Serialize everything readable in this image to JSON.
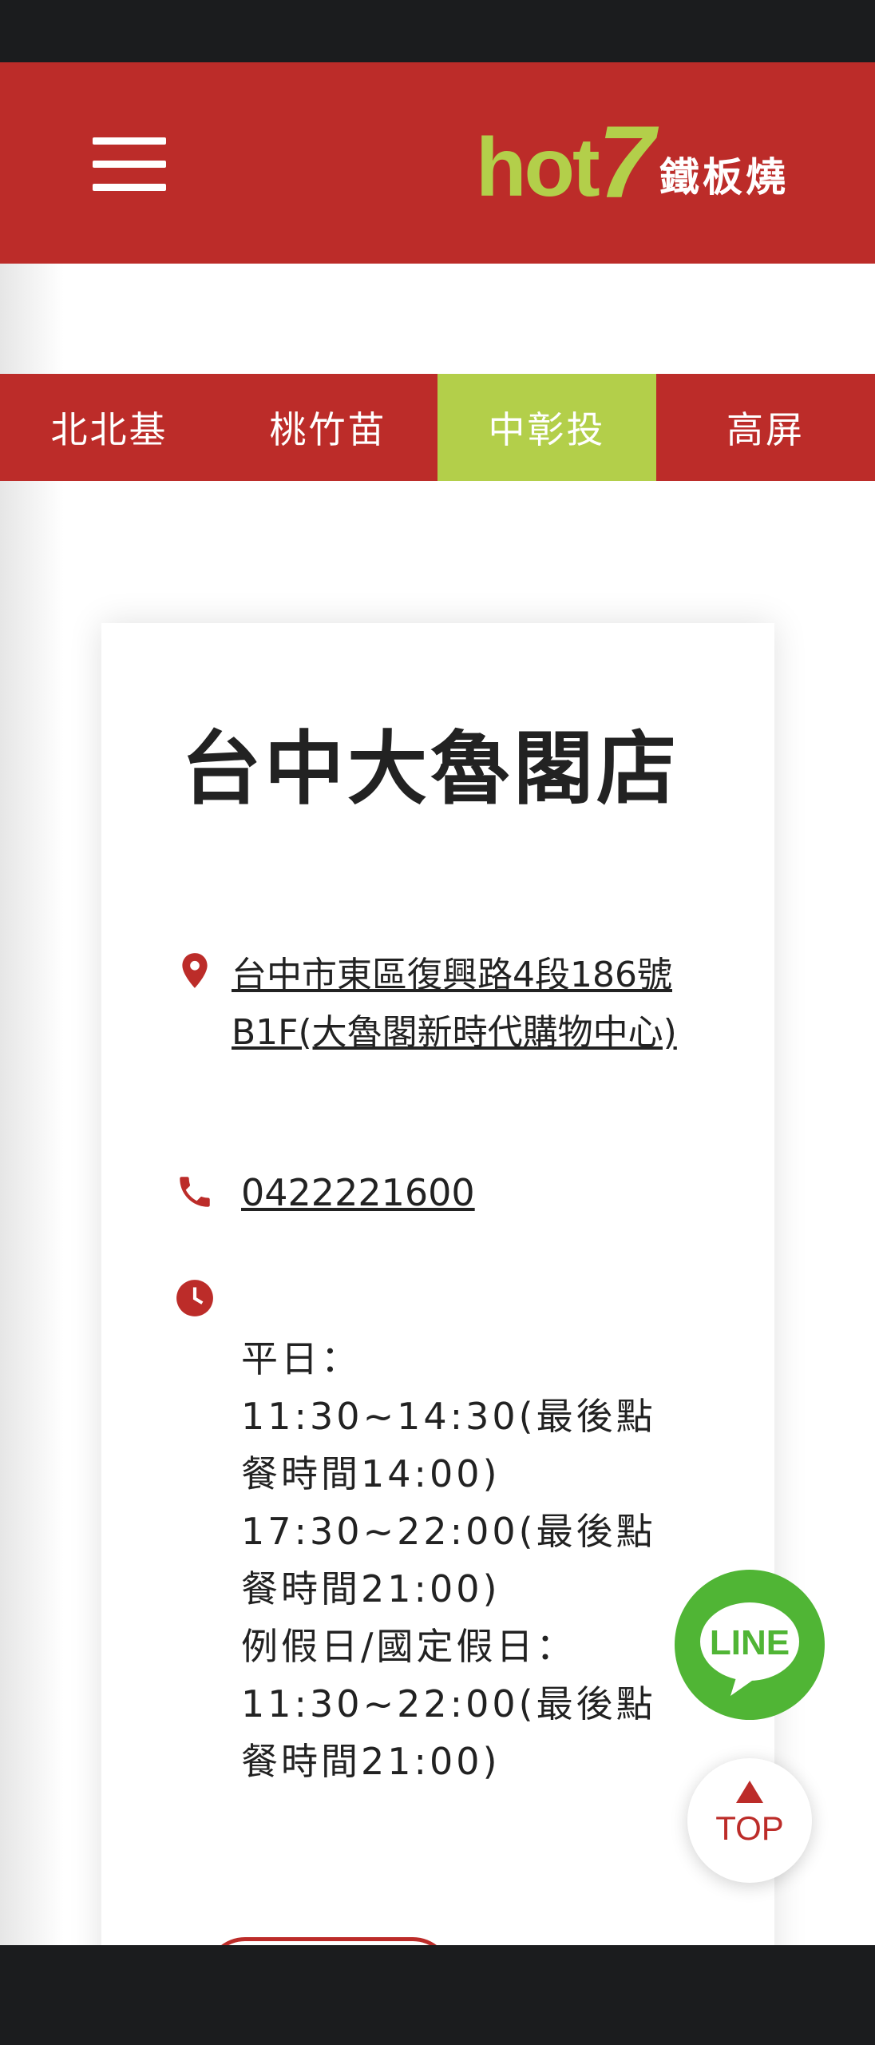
{
  "header": {
    "logo": {
      "text_hot": "hot",
      "text_seven": "7",
      "text_cn": "鐵板燒"
    }
  },
  "region_tabs": [
    {
      "label": "北北基",
      "active": false
    },
    {
      "label": "桃竹苗",
      "active": false
    },
    {
      "label": "中彰投",
      "active": true
    },
    {
      "label": "高屏",
      "active": false
    }
  ],
  "store": {
    "name": "台中大魯閣店",
    "address": "台中市東區復興路4段186號B1F(大魯閣新時代購物中心)",
    "phone": "0422221600",
    "hours": [
      "平日：",
      "11:30~14:30(最後點餐時間14:00)",
      "17:30~22:00(最後點餐時間21:00)",
      "例假日/國定假日：",
      "11:30~22:00(最後點餐時間21:00)"
    ]
  },
  "floating": {
    "line_label": "LINE",
    "top_label": "TOP"
  },
  "colors": {
    "brand_red": "#bc2c29",
    "brand_green": "#b3cf4a",
    "line_green": "#50b535"
  },
  "icons": [
    "menu-icon",
    "location-pin-icon",
    "phone-icon",
    "clock-icon",
    "line-icon",
    "arrow-up-icon"
  ]
}
